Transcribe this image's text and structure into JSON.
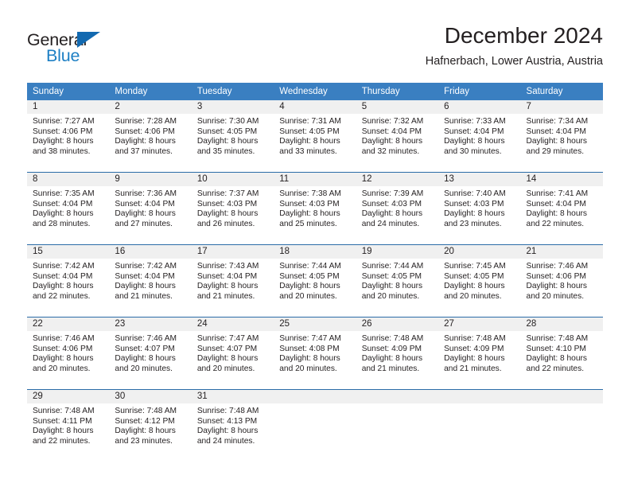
{
  "brand": {
    "name_part1": "General",
    "name_part2": "Blue",
    "triangle_color": "#1269b0",
    "blue_color": "#1d7fc4"
  },
  "header": {
    "title": "December 2024",
    "subtitle": "Hafnerbach, Lower Austria, Austria"
  },
  "theme": {
    "header_band": "#3a7fc1",
    "row_separator": "#2b6ca8",
    "daynum_band": "#f0f0f0",
    "text": "#231f20"
  },
  "calendar": {
    "weekday_headers": [
      "Sunday",
      "Monday",
      "Tuesday",
      "Wednesday",
      "Thursday",
      "Friday",
      "Saturday"
    ],
    "weeks": [
      [
        {
          "day": "1",
          "sunrise": "Sunrise: 7:27 AM",
          "sunset": "Sunset: 4:06 PM",
          "daylight1": "Daylight: 8 hours",
          "daylight2": "and 38 minutes."
        },
        {
          "day": "2",
          "sunrise": "Sunrise: 7:28 AM",
          "sunset": "Sunset: 4:06 PM",
          "daylight1": "Daylight: 8 hours",
          "daylight2": "and 37 minutes."
        },
        {
          "day": "3",
          "sunrise": "Sunrise: 7:30 AM",
          "sunset": "Sunset: 4:05 PM",
          "daylight1": "Daylight: 8 hours",
          "daylight2": "and 35 minutes."
        },
        {
          "day": "4",
          "sunrise": "Sunrise: 7:31 AM",
          "sunset": "Sunset: 4:05 PM",
          "daylight1": "Daylight: 8 hours",
          "daylight2": "and 33 minutes."
        },
        {
          "day": "5",
          "sunrise": "Sunrise: 7:32 AM",
          "sunset": "Sunset: 4:04 PM",
          "daylight1": "Daylight: 8 hours",
          "daylight2": "and 32 minutes."
        },
        {
          "day": "6",
          "sunrise": "Sunrise: 7:33 AM",
          "sunset": "Sunset: 4:04 PM",
          "daylight1": "Daylight: 8 hours",
          "daylight2": "and 30 minutes."
        },
        {
          "day": "7",
          "sunrise": "Sunrise: 7:34 AM",
          "sunset": "Sunset: 4:04 PM",
          "daylight1": "Daylight: 8 hours",
          "daylight2": "and 29 minutes."
        }
      ],
      [
        {
          "day": "8",
          "sunrise": "Sunrise: 7:35 AM",
          "sunset": "Sunset: 4:04 PM",
          "daylight1": "Daylight: 8 hours",
          "daylight2": "and 28 minutes."
        },
        {
          "day": "9",
          "sunrise": "Sunrise: 7:36 AM",
          "sunset": "Sunset: 4:04 PM",
          "daylight1": "Daylight: 8 hours",
          "daylight2": "and 27 minutes."
        },
        {
          "day": "10",
          "sunrise": "Sunrise: 7:37 AM",
          "sunset": "Sunset: 4:03 PM",
          "daylight1": "Daylight: 8 hours",
          "daylight2": "and 26 minutes."
        },
        {
          "day": "11",
          "sunrise": "Sunrise: 7:38 AM",
          "sunset": "Sunset: 4:03 PM",
          "daylight1": "Daylight: 8 hours",
          "daylight2": "and 25 minutes."
        },
        {
          "day": "12",
          "sunrise": "Sunrise: 7:39 AM",
          "sunset": "Sunset: 4:03 PM",
          "daylight1": "Daylight: 8 hours",
          "daylight2": "and 24 minutes."
        },
        {
          "day": "13",
          "sunrise": "Sunrise: 7:40 AM",
          "sunset": "Sunset: 4:03 PM",
          "daylight1": "Daylight: 8 hours",
          "daylight2": "and 23 minutes."
        },
        {
          "day": "14",
          "sunrise": "Sunrise: 7:41 AM",
          "sunset": "Sunset: 4:04 PM",
          "daylight1": "Daylight: 8 hours",
          "daylight2": "and 22 minutes."
        }
      ],
      [
        {
          "day": "15",
          "sunrise": "Sunrise: 7:42 AM",
          "sunset": "Sunset: 4:04 PM",
          "daylight1": "Daylight: 8 hours",
          "daylight2": "and 22 minutes."
        },
        {
          "day": "16",
          "sunrise": "Sunrise: 7:42 AM",
          "sunset": "Sunset: 4:04 PM",
          "daylight1": "Daylight: 8 hours",
          "daylight2": "and 21 minutes."
        },
        {
          "day": "17",
          "sunrise": "Sunrise: 7:43 AM",
          "sunset": "Sunset: 4:04 PM",
          "daylight1": "Daylight: 8 hours",
          "daylight2": "and 21 minutes."
        },
        {
          "day": "18",
          "sunrise": "Sunrise: 7:44 AM",
          "sunset": "Sunset: 4:05 PM",
          "daylight1": "Daylight: 8 hours",
          "daylight2": "and 20 minutes."
        },
        {
          "day": "19",
          "sunrise": "Sunrise: 7:44 AM",
          "sunset": "Sunset: 4:05 PM",
          "daylight1": "Daylight: 8 hours",
          "daylight2": "and 20 minutes."
        },
        {
          "day": "20",
          "sunrise": "Sunrise: 7:45 AM",
          "sunset": "Sunset: 4:05 PM",
          "daylight1": "Daylight: 8 hours",
          "daylight2": "and 20 minutes."
        },
        {
          "day": "21",
          "sunrise": "Sunrise: 7:46 AM",
          "sunset": "Sunset: 4:06 PM",
          "daylight1": "Daylight: 8 hours",
          "daylight2": "and 20 minutes."
        }
      ],
      [
        {
          "day": "22",
          "sunrise": "Sunrise: 7:46 AM",
          "sunset": "Sunset: 4:06 PM",
          "daylight1": "Daylight: 8 hours",
          "daylight2": "and 20 minutes."
        },
        {
          "day": "23",
          "sunrise": "Sunrise: 7:46 AM",
          "sunset": "Sunset: 4:07 PM",
          "daylight1": "Daylight: 8 hours",
          "daylight2": "and 20 minutes."
        },
        {
          "day": "24",
          "sunrise": "Sunrise: 7:47 AM",
          "sunset": "Sunset: 4:07 PM",
          "daylight1": "Daylight: 8 hours",
          "daylight2": "and 20 minutes."
        },
        {
          "day": "25",
          "sunrise": "Sunrise: 7:47 AM",
          "sunset": "Sunset: 4:08 PM",
          "daylight1": "Daylight: 8 hours",
          "daylight2": "and 20 minutes."
        },
        {
          "day": "26",
          "sunrise": "Sunrise: 7:48 AM",
          "sunset": "Sunset: 4:09 PM",
          "daylight1": "Daylight: 8 hours",
          "daylight2": "and 21 minutes."
        },
        {
          "day": "27",
          "sunrise": "Sunrise: 7:48 AM",
          "sunset": "Sunset: 4:09 PM",
          "daylight1": "Daylight: 8 hours",
          "daylight2": "and 21 minutes."
        },
        {
          "day": "28",
          "sunrise": "Sunrise: 7:48 AM",
          "sunset": "Sunset: 4:10 PM",
          "daylight1": "Daylight: 8 hours",
          "daylight2": "and 22 minutes."
        }
      ],
      [
        {
          "day": "29",
          "sunrise": "Sunrise: 7:48 AM",
          "sunset": "Sunset: 4:11 PM",
          "daylight1": "Daylight: 8 hours",
          "daylight2": "and 22 minutes."
        },
        {
          "day": "30",
          "sunrise": "Sunrise: 7:48 AM",
          "sunset": "Sunset: 4:12 PM",
          "daylight1": "Daylight: 8 hours",
          "daylight2": "and 23 minutes."
        },
        {
          "day": "31",
          "sunrise": "Sunrise: 7:48 AM",
          "sunset": "Sunset: 4:13 PM",
          "daylight1": "Daylight: 8 hours",
          "daylight2": "and 24 minutes."
        },
        {
          "day": "",
          "sunrise": "",
          "sunset": "",
          "daylight1": "",
          "daylight2": ""
        },
        {
          "day": "",
          "sunrise": "",
          "sunset": "",
          "daylight1": "",
          "daylight2": ""
        },
        {
          "day": "",
          "sunrise": "",
          "sunset": "",
          "daylight1": "",
          "daylight2": ""
        },
        {
          "day": "",
          "sunrise": "",
          "sunset": "",
          "daylight1": "",
          "daylight2": ""
        }
      ]
    ]
  }
}
